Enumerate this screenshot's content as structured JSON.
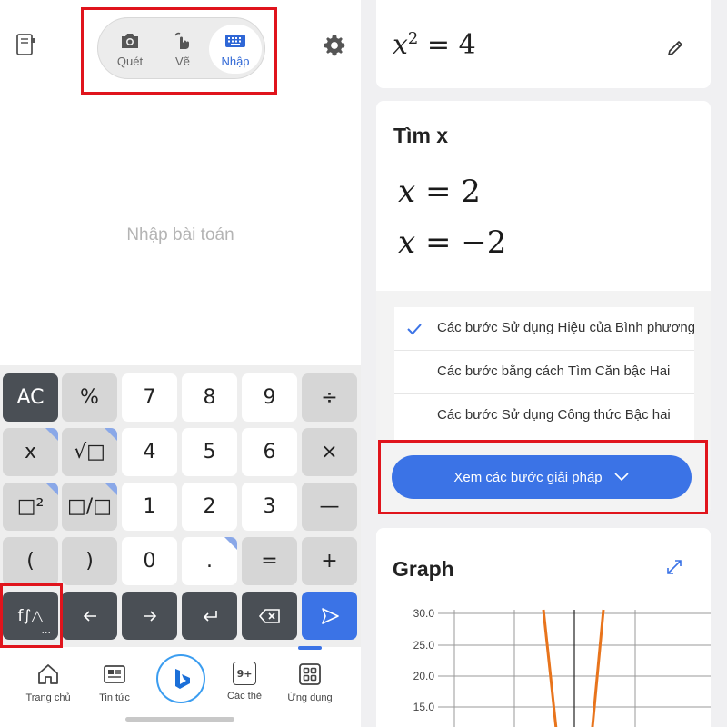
{
  "modes": [
    {
      "label": "Quét",
      "icon": "camera-icon"
    },
    {
      "label": "Vẽ",
      "icon": "draw-hand-icon"
    },
    {
      "label": "Nhập",
      "icon": "keyboard-icon",
      "active": true
    }
  ],
  "input": {
    "placeholder": "Nhập bài toán"
  },
  "keypad": {
    "row1": [
      "AC",
      "%",
      "7",
      "8",
      "9",
      "÷"
    ],
    "row2": [
      "x",
      "√□",
      "4",
      "5",
      "6",
      "×"
    ],
    "row3": [
      "□²",
      "□/□",
      "1",
      "2",
      "3",
      "—"
    ],
    "row4": [
      "(",
      ")",
      "0",
      ".",
      "=",
      "+"
    ],
    "fn_label": "f∫△",
    "fn_more": "..."
  },
  "nav": [
    {
      "label": "Trang chủ",
      "icon": "home-icon"
    },
    {
      "label": "Tin tức",
      "icon": "news-icon"
    },
    {
      "label": "",
      "icon": "bing-icon"
    },
    {
      "label": "Các thẻ",
      "icon": "tabs-icon",
      "badge": "9+"
    },
    {
      "label": "Ứng dụng",
      "icon": "apps-icon"
    }
  ],
  "problem": {
    "equation": "x² = 4",
    "base": "x",
    "exp": "2",
    "rhs": "= 4"
  },
  "solution": {
    "title": "Tìm x",
    "answers": [
      {
        "var": "x",
        "rhs": "= 2"
      },
      {
        "var": "x",
        "rhs": "= −2"
      }
    ],
    "methods": [
      {
        "label": "Các bước Sử dụng Hiệu của Bình phương",
        "selected": true
      },
      {
        "label": "Các bước bằng cách Tìm Căn bậc Hai",
        "selected": false
      },
      {
        "label": "Các bước Sử dụng Công thức Bậc hai",
        "selected": false
      }
    ],
    "steps_button": "Xem các bước giải pháp"
  },
  "graph": {
    "title": "Graph",
    "y_ticks": [
      "30.0",
      "25.0",
      "20.0",
      "15.0"
    ]
  },
  "colors": {
    "accent": "#3b73e6",
    "highlight": "#e0141c",
    "curve": "#e8741c"
  }
}
